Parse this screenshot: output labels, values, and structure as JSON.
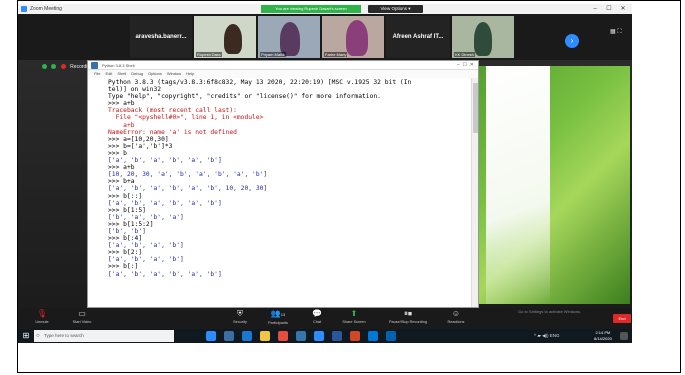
{
  "window": {
    "title": "Zoom Meeting",
    "share_banner": "You are viewing Rupesh Dasari's screen",
    "view_options": "View Options"
  },
  "gallery": {
    "tiles": [
      {
        "name": "aravesha.banerr...",
        "kind": "name-only"
      },
      {
        "name": "Rupesh Dara",
        "kind": "video"
      },
      {
        "name": "Priyam Mallik",
        "kind": "video"
      },
      {
        "name": "Farhe Mariy",
        "kind": "video"
      },
      {
        "name": "Afreen Ashraf IT...",
        "kind": "name-only"
      },
      {
        "name": "KK Dinesh",
        "kind": "video"
      }
    ]
  },
  "recording": {
    "label": "Recording"
  },
  "idle": {
    "title": "Python 3.8.3 Shell",
    "menu": [
      "File",
      "Edit",
      "Shell",
      "Debug",
      "Options",
      "Window",
      "Help"
    ],
    "lines": [
      {
        "t": "Python 3.8.3 (tags/v3.8.3:6f8c832, May 13 2020, 22:20:19) [MSC v.1925 32 bit (In",
        "k": "normal"
      },
      {
        "t": "tel)] on win32",
        "k": "normal"
      },
      {
        "t": "Type \"help\", \"copyright\", \"credits\" or \"license()\" for more information.",
        "k": "normal"
      },
      {
        "t": ">>> a+b",
        "k": "normal"
      },
      {
        "t": "Traceback (most recent call last):",
        "k": "error"
      },
      {
        "t": "  File \"<pyshell#0>\", line 1, in <module>",
        "k": "error"
      },
      {
        "t": "    a+b",
        "k": "error"
      },
      {
        "t": "NameError: name 'a' is not defined",
        "k": "error"
      },
      {
        "t": ">>> a=[10,20,30]",
        "k": "normal"
      },
      {
        "t": ">>> b=['a','b']*3",
        "k": "normal"
      },
      {
        "t": ">>> b",
        "k": "normal"
      },
      {
        "t": "['a', 'b', 'a', 'b', 'a', 'b']",
        "k": "output"
      },
      {
        "t": ">>> a+b",
        "k": "normal"
      },
      {
        "t": "[10, 20, 30, 'a', 'b', 'a', 'b', 'a', 'b']",
        "k": "output"
      },
      {
        "t": ">>> b+a",
        "k": "normal"
      },
      {
        "t": "['a', 'b', 'a', 'b', 'a', 'b', 10, 20, 30]",
        "k": "output"
      },
      {
        "t": ">>> b[::]",
        "k": "normal"
      },
      {
        "t": "['a', 'b', 'a', 'b', 'a', 'b']",
        "k": "output"
      },
      {
        "t": ">>> b[1:5]",
        "k": "normal"
      },
      {
        "t": "['b', 'a', 'b', 'a']",
        "k": "output"
      },
      {
        "t": ">>> b[1:5:2]",
        "k": "normal"
      },
      {
        "t": "['b', 'b']",
        "k": "output"
      },
      {
        "t": ">>> b[:4]",
        "k": "normal"
      },
      {
        "t": "['a', 'b', 'a', 'b']",
        "k": "output"
      },
      {
        "t": ">>> b[2:]",
        "k": "normal"
      },
      {
        "t": "['a', 'b', 'a', 'b']",
        "k": "output"
      },
      {
        "t": ">>> b[:]",
        "k": "normal"
      },
      {
        "t": "['a', 'b', 'a', 'b', 'a', 'b']",
        "k": "output"
      }
    ]
  },
  "toolbar": {
    "unmute": "Unmute",
    "start_video": "Start Video",
    "security": "Security",
    "participants": "Participants",
    "participants_count": "13",
    "chat": "Chat",
    "share_screen": "Share Screen",
    "pause_recording": "Pause/Stop Recording",
    "reactions": "Reactions",
    "end": "End",
    "activate_windows": "Go to Settings to activate Windows."
  },
  "taskbar": {
    "search_placeholder": "Type here to search",
    "time": "2:14 PM",
    "date": "8/14/2020",
    "tray_lang": "ENG"
  },
  "colors": {
    "zoom_blue": "#2d8cff",
    "share_green": "#2fb34a",
    "end_red": "#e02828"
  }
}
